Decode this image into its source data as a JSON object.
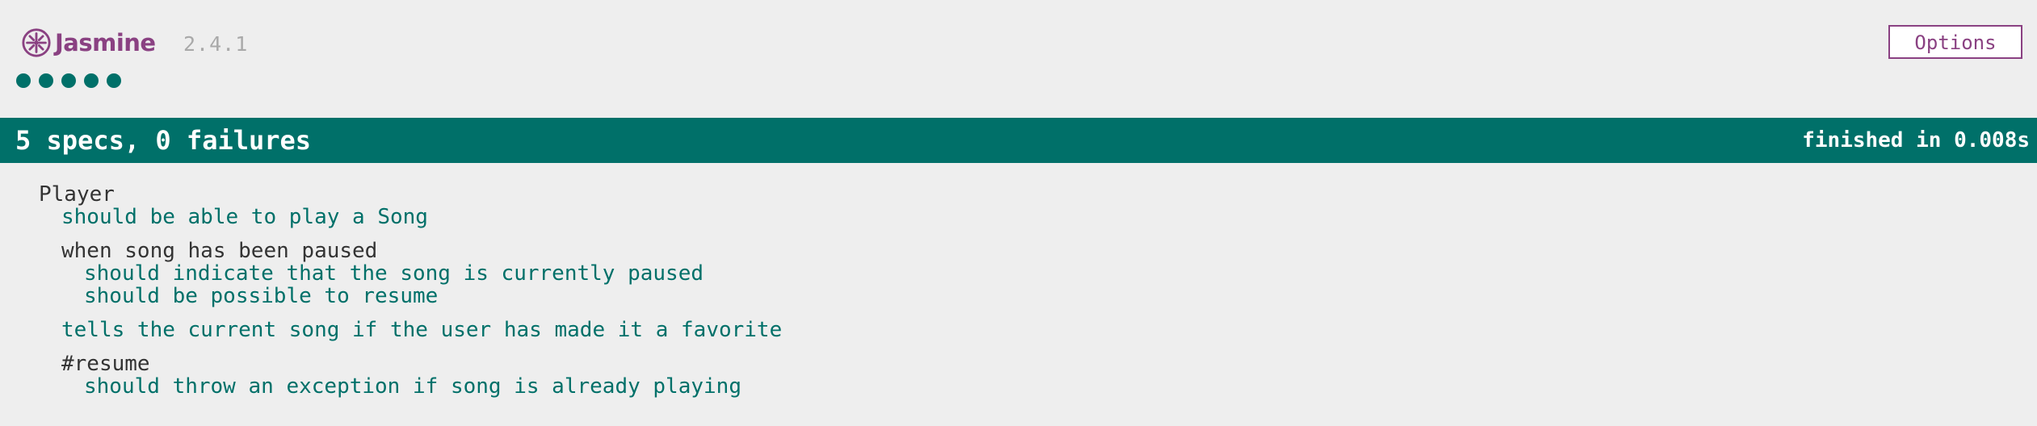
{
  "header": {
    "app_name": "Jasmine",
    "version": "2.4.1",
    "options_label": "Options",
    "brand_color": "#8a4182",
    "logo_icon": "jasmine-flower-icon"
  },
  "symbol_summary": {
    "passed_count": 5,
    "symbol_color": "#007069"
  },
  "status_bar": {
    "summary": "5 specs, 0 failures",
    "duration": "finished in 0.008s",
    "color": "#007069"
  },
  "results": {
    "player_suite": {
      "title": "Player",
      "spec_play_song": "should be able to play a Song",
      "paused_suite": {
        "title": "when song has been paused",
        "spec_indicate_paused": "should indicate that the song is currently paused",
        "spec_possible_resume": "should be possible to resume"
      },
      "spec_favorite": "tells the current song if the user has made it a favorite",
      "resume_suite": {
        "title": "#resume",
        "spec_throw_exception": "should throw an exception if song is already playing"
      }
    }
  }
}
